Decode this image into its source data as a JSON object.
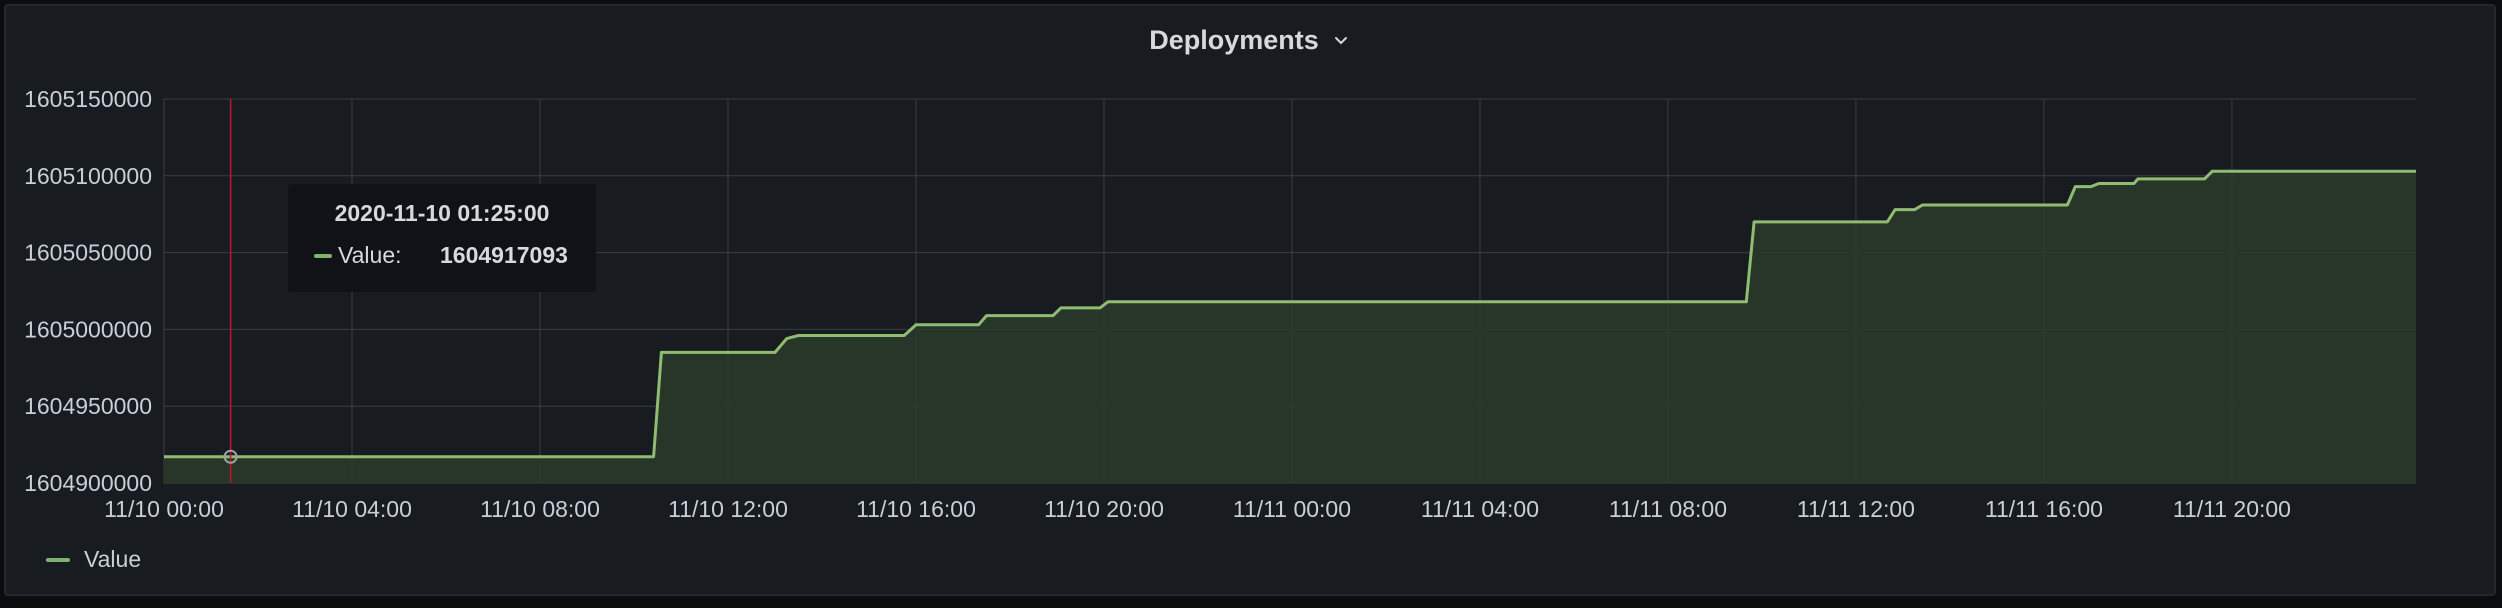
{
  "panel": {
    "title": "Deployments",
    "chevron_icon": "chevron-down-icon"
  },
  "legend": {
    "label": "Value",
    "color": "#7eb26d"
  },
  "tooltip": {
    "time": "2020-11-10 01:25:00",
    "label": "Value:",
    "value": "1604917093"
  },
  "colors": {
    "background": "#181b1f",
    "line": "#8fbc71",
    "fill": "#2c3a2c",
    "grid": "#3a3d44",
    "crosshair": "#c4162a"
  },
  "chart_data": {
    "type": "area",
    "title": "Deployments",
    "xlabel": "",
    "ylabel": "",
    "x_ticks": [
      "11/10 00:00",
      "11/10 04:00",
      "11/10 08:00",
      "11/10 12:00",
      "11/10 16:00",
      "11/10 20:00",
      "11/11 00:00",
      "11/11 04:00",
      "11/11 08:00",
      "11/11 12:00",
      "11/11 16:00",
      "11/11 20:00"
    ],
    "y_ticks": [
      1604900000,
      1604950000,
      1605000000,
      1605050000,
      1605100000,
      1605150000
    ],
    "xlim": [
      "11/10 00:00",
      "11/11 23:55"
    ],
    "ylim": [
      1604900000,
      1605150000
    ],
    "grid": true,
    "legend_position": "bottom-left",
    "series": [
      {
        "name": "Value",
        "x": [
          "11/10 00:00",
          "11/10 10:25",
          "11/10 10:35",
          "11/10 13:00",
          "11/10 13:15",
          "11/10 13:30",
          "11/10 15:45",
          "11/10 16:00",
          "11/10 17:20",
          "11/10 17:30",
          "11/10 18:55",
          "11/10 19:05",
          "11/10 19:55",
          "11/10 20:05",
          "11/11 09:40",
          "11/11 09:50",
          "11/11 12:40",
          "11/11 12:50",
          "11/11 13:15",
          "11/11 13:25",
          "11/11 16:30",
          "11/11 16:40",
          "11/11 17:00",
          "11/11 17:10",
          "11/11 17:55",
          "11/11 18:00",
          "11/11 19:25",
          "11/11 19:35",
          "11/11 23:55"
        ],
        "y": [
          1604917093,
          1604917093,
          1604985000,
          1604985000,
          1604994000,
          1604996000,
          1604996000,
          1605003000,
          1605003000,
          1605009000,
          1605009000,
          1605014000,
          1605014000,
          1605018000,
          1605018000,
          1605070000,
          1605070000,
          1605078000,
          1605078000,
          1605081000,
          1605081000,
          1605093000,
          1605093000,
          1605095000,
          1605095000,
          1605098000,
          1605098000,
          1605103000,
          1605103000
        ]
      }
    ],
    "hover": {
      "x": "11/10 01:25",
      "y": 1604917093
    }
  }
}
